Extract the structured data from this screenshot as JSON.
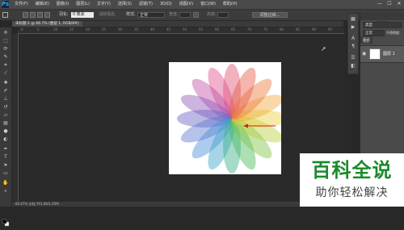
{
  "app": {
    "logo": "Ps"
  },
  "menubar": {
    "items": [
      "文件(F)",
      "编辑(E)",
      "图像(I)",
      "图层(L)",
      "文字(Y)",
      "选择(S)",
      "滤镜(T)",
      "3D(D)",
      "视图(V)",
      "窗口(W)",
      "帮助(H)"
    ],
    "window_controls": [
      "—",
      "☐",
      "✕"
    ]
  },
  "options": {
    "feather_label": "羽化:",
    "feather_value": "0 像素",
    "antialias_label": "消除锯齿",
    "style_label": "样式:",
    "style_value": "正常",
    "width_label": "宽度:",
    "height_label": "高度:",
    "refine_button": "调整边缘..."
  },
  "document": {
    "tab_title": "未标题-1 @ 66.7% (图层 1, RGB/8#)",
    "ruler_marks": [
      "0",
      "5",
      "10",
      "15",
      "20",
      "25",
      "30",
      "35",
      "40",
      "45",
      "50",
      "55",
      "60",
      "65",
      "70",
      "75",
      "80",
      "85",
      "90",
      "95"
    ],
    "status": "66.67%    文档:791.0K/1.05M"
  },
  "layers_panel": {
    "tabs": [
      "图层",
      "通道",
      "路径"
    ],
    "kind_label": "类型",
    "blend_mode": "正常",
    "opacity_label": "不透明度:",
    "lock_label": "锁定:",
    "layer_name": "图层 1"
  },
  "watermark": {
    "title": "百科全说",
    "subtitle": "助你轻松解决"
  },
  "colors": {
    "arrow": "#cc1f1f",
    "watermark_green": "#1a8a2a"
  }
}
